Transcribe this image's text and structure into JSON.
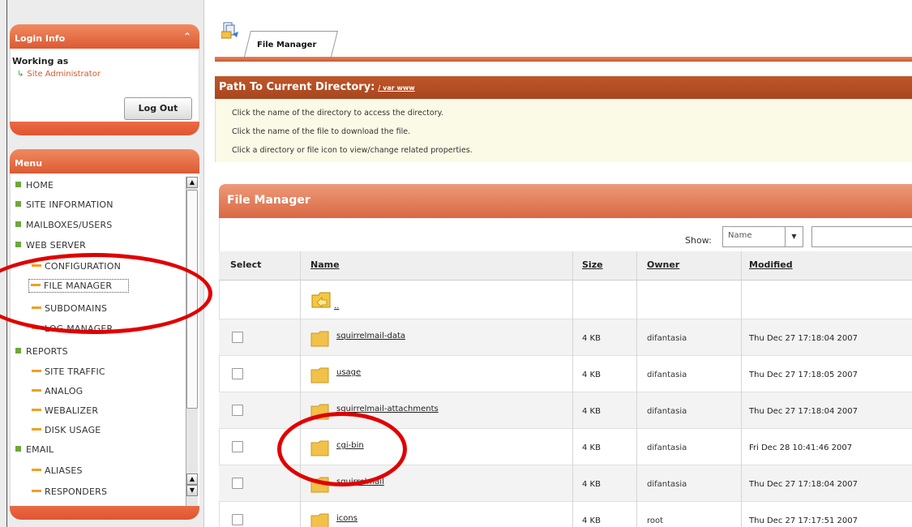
{
  "login": {
    "title": "Login Info",
    "collapse_icon": "double-chevron-up-icon",
    "working_as": "Working as",
    "role": "Site Administrator",
    "logout": "Log Out"
  },
  "menu": {
    "title": "Menu",
    "items": [
      {
        "label": "HOME",
        "level": 1
      },
      {
        "label": "SITE INFORMATION",
        "level": 1
      },
      {
        "label": "MAILBOXES/USERS",
        "level": 1
      },
      {
        "label": "WEB SERVER",
        "level": 1
      },
      {
        "label": "CONFIGURATION",
        "level": 2
      },
      {
        "label": "FILE MANAGER",
        "level": 2,
        "active": true
      },
      {
        "label": "SUBDOMAINS",
        "level": 2
      },
      {
        "label": "LOG MANAGER",
        "level": 2
      },
      {
        "label": "REPORTS",
        "level": 1
      },
      {
        "label": "SITE TRAFFIC",
        "level": 2
      },
      {
        "label": "ANALOG",
        "level": 2
      },
      {
        "label": "WEBALIZER",
        "level": 2
      },
      {
        "label": "DISK USAGE",
        "level": 2
      },
      {
        "label": "EMAIL",
        "level": 1
      },
      {
        "label": "ALIASES",
        "level": 2
      },
      {
        "label": "RESPONDERS",
        "level": 2
      }
    ]
  },
  "tab": {
    "label": "File Manager"
  },
  "path": {
    "title": "Path To Current Directory:",
    "dir": "/ var www"
  },
  "info": [
    "Click the name of the directory to access the directory.",
    "Click the name of the file to download the file.",
    "Click a directory or file icon to view/change related properties."
  ],
  "fm": {
    "title": "File Manager",
    "show_label": "Show:",
    "show_value": "Name",
    "columns": {
      "select": "Select",
      "name": "Name",
      "size": "Size",
      "owner": "Owner",
      "modified": "Modified"
    },
    "parent": "..",
    "rows": [
      {
        "name": "squirrelmail-data",
        "size": "4 KB",
        "owner": "difantasia",
        "modified": "Thu Dec 27 17:18:04 2007"
      },
      {
        "name": "usage",
        "size": "4 KB",
        "owner": "difantasia",
        "modified": "Thu Dec 27 17:18:05 2007"
      },
      {
        "name": "squirrelmail-attachments",
        "size": "4 KB",
        "owner": "difantasia",
        "modified": "Thu Dec 27 17:18:04 2007"
      },
      {
        "name": "cgi-bin",
        "size": "4 KB",
        "owner": "difantasia",
        "modified": "Fri Dec 28 10:41:46 2007"
      },
      {
        "name": "squirrelmail",
        "size": "4 KB",
        "owner": "difantasia",
        "modified": "Thu Dec 27 17:18:04 2007"
      },
      {
        "name": "icons",
        "size": "4 KB",
        "owner": "root",
        "modified": "Thu Dec 27 17:17:51 2007"
      }
    ]
  },
  "colors": {
    "accent": "#d9633a",
    "header_dark": "#a8461f",
    "info_bg": "#fafae6",
    "highlight": "#e00000"
  }
}
